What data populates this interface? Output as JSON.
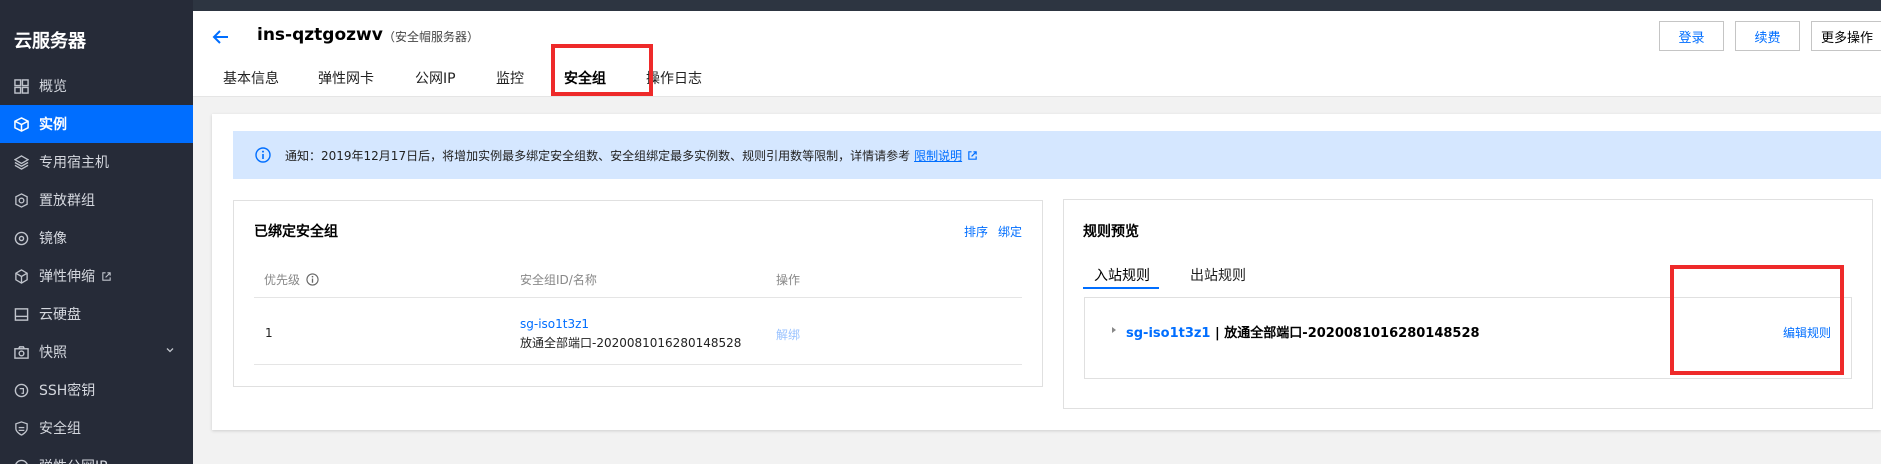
{
  "sidebar": {
    "title": "云服务器",
    "items": [
      {
        "label": "概览",
        "icon": "grid-icon"
      },
      {
        "label": "实例",
        "icon": "cube-icon"
      },
      {
        "label": "专用宿主机",
        "icon": "layers-icon"
      },
      {
        "label": "置放群组",
        "icon": "placement-icon"
      },
      {
        "label": "镜像",
        "icon": "disc-icon"
      },
      {
        "label": "弹性伸缩",
        "icon": "autoscale-icon"
      },
      {
        "label": "云硬盘",
        "icon": "disk-icon"
      },
      {
        "label": "快照",
        "icon": "camera-icon"
      },
      {
        "label": "SSH密钥",
        "icon": "key-icon"
      },
      {
        "label": "安全组",
        "icon": "shield-icon"
      },
      {
        "label": "弹性公网IP",
        "icon": "ip-icon"
      }
    ]
  },
  "header": {
    "instance_name": "ins-qztgozwv",
    "instance_sub": "（安全帽服务器）",
    "login_label": "登录",
    "renew_label": "续费",
    "more_label": "更多操作",
    "tabs": [
      "基本信息",
      "弹性网卡",
      "公网IP",
      "监控",
      "安全组",
      "操作日志"
    ],
    "active_tab": "安全组"
  },
  "notice": {
    "text": "通知：2019年12月17日后，将增加实例最多绑定安全组数、安全组绑定最多实例数、规则引用数等限制，详情请参考",
    "link": "限制说明"
  },
  "bound_panel": {
    "title": "已绑定安全组",
    "sort_label": "排序",
    "bind_label": "绑定",
    "columns": [
      "优先级",
      "安全组ID/名称",
      "操作"
    ],
    "rows": [
      {
        "priority": "1",
        "sg_id": "sg-iso1t3z1",
        "sg_name": "放通全部端口-2020081016280148528",
        "action": "解绑"
      }
    ]
  },
  "rules_panel": {
    "title": "规则预览",
    "tabs": [
      "入站规则",
      "出站规则"
    ],
    "active_tab": "入站规则",
    "row_id": "sg-iso1t3z1",
    "row_sep": " | ",
    "row_name": "放通全部端口-2020081016280148528",
    "edit_label": "编辑规则"
  },
  "colors": {
    "accent": "#006eff",
    "sidebar_bg": "#262b38",
    "highlight": "#ee2a2a"
  }
}
